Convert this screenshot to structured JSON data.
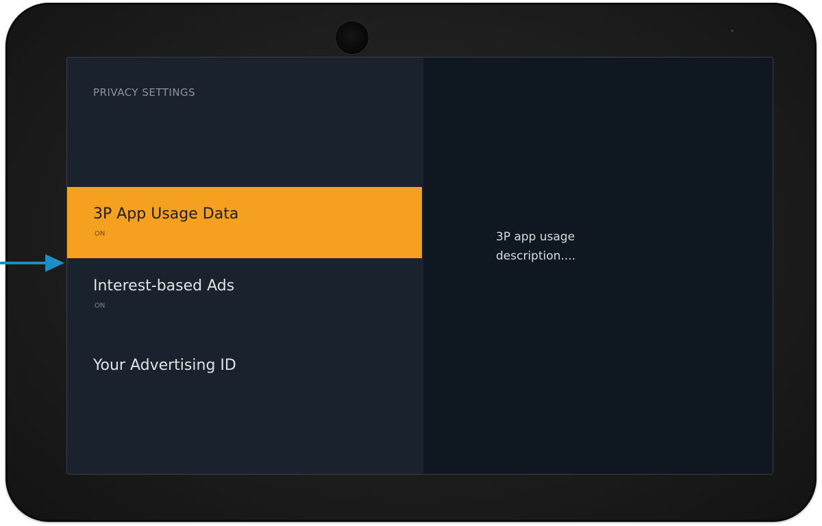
{
  "screen": {
    "title": "PRIVACY SETTINGS",
    "menu_items": [
      {
        "label": "3P App Usage Data",
        "status": "ON",
        "selected": true
      },
      {
        "label": "Interest-based Ads",
        "status": "ON",
        "selected": false
      },
      {
        "label": "Your Advertising ID",
        "status": "",
        "selected": false
      }
    ],
    "detail": {
      "description": "3P app usage description...."
    }
  },
  "colors": {
    "highlight": "#f5a01f",
    "arrow": "#1a8fc4",
    "screen_bg": "#0f1821",
    "menu_bg": "#1a232d"
  },
  "icons": {
    "pointer": "arrow-right-icon"
  }
}
